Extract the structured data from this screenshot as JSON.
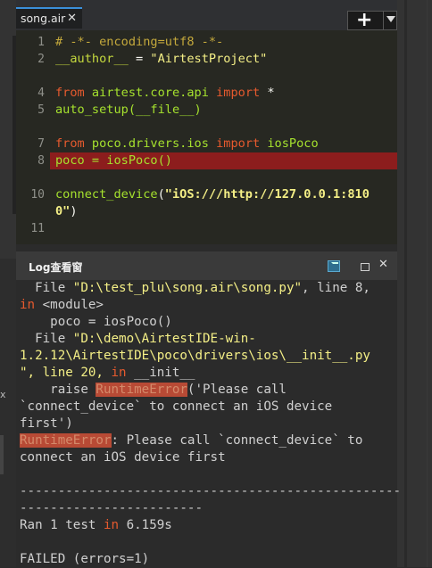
{
  "editor": {
    "tab": {
      "label": "song.air",
      "close": "✕"
    },
    "add_button": {
      "plus": "+"
    },
    "lines": {
      "n1": "1",
      "n2": "2",
      "n4": "4",
      "n5": "5",
      "n7": "7",
      "n8": "8",
      "n10": "10",
      "n11": "11",
      "l1": "# -*- encoding=utf8 -*-",
      "l2a": "__author__",
      "l2b": " = ",
      "l2c": "\"AirtestProject\"",
      "l4a": "from",
      "l4b": " airtest.core.api ",
      "l4c": "import",
      "l4d": " *",
      "l5": "auto_setup(__file__)",
      "l7a": "from",
      "l7b": " poco.drivers.ios ",
      "l7c": "import",
      "l7d": " iosPoco",
      "l8": "poco = iosPoco()",
      "l10a": "connect_device",
      "l10b": "(",
      "l10c": "\"iOS:///http://127.0.0.1:810",
      "l10d": "0\"",
      "l10e": ")"
    }
  },
  "log": {
    "title": "Log查看窗",
    "l1a": "  File ",
    "l1b": "\"D:\\test_plu\\song.air\\song.py\"",
    "l1c": ", line 8,",
    "l2a": "in",
    "l2b": " <module>",
    "l3": "    poco = iosPoco()",
    "l4a": "  File ",
    "l4b": "\"D:\\demo\\AirtestIDE-win-",
    "l5": "1.2.12\\AirtestIDE\\poco\\drivers\\ios\\__init__.py",
    "l6a": "\", line 20, ",
    "l6b": "in",
    "l6c": " __init__",
    "l7a": "    raise ",
    "l7b": "RuntimeError",
    "l7c": "('Please call",
    "l8": "`connect_device` to connect an iOS device",
    "l9": "first')",
    "l10a": "RuntimeError",
    "l10b": ": Please call `connect_device` to",
    "l11": "connect an iOS device first",
    "l12": "--------------------------------------------------",
    "l13": "------------------------",
    "l14a": "Ran 1 test ",
    "l14b": "in",
    "l14c": " 6.159s",
    "l15": "FAILED (errors=1)"
  },
  "left_panel": {
    "close": "x"
  }
}
